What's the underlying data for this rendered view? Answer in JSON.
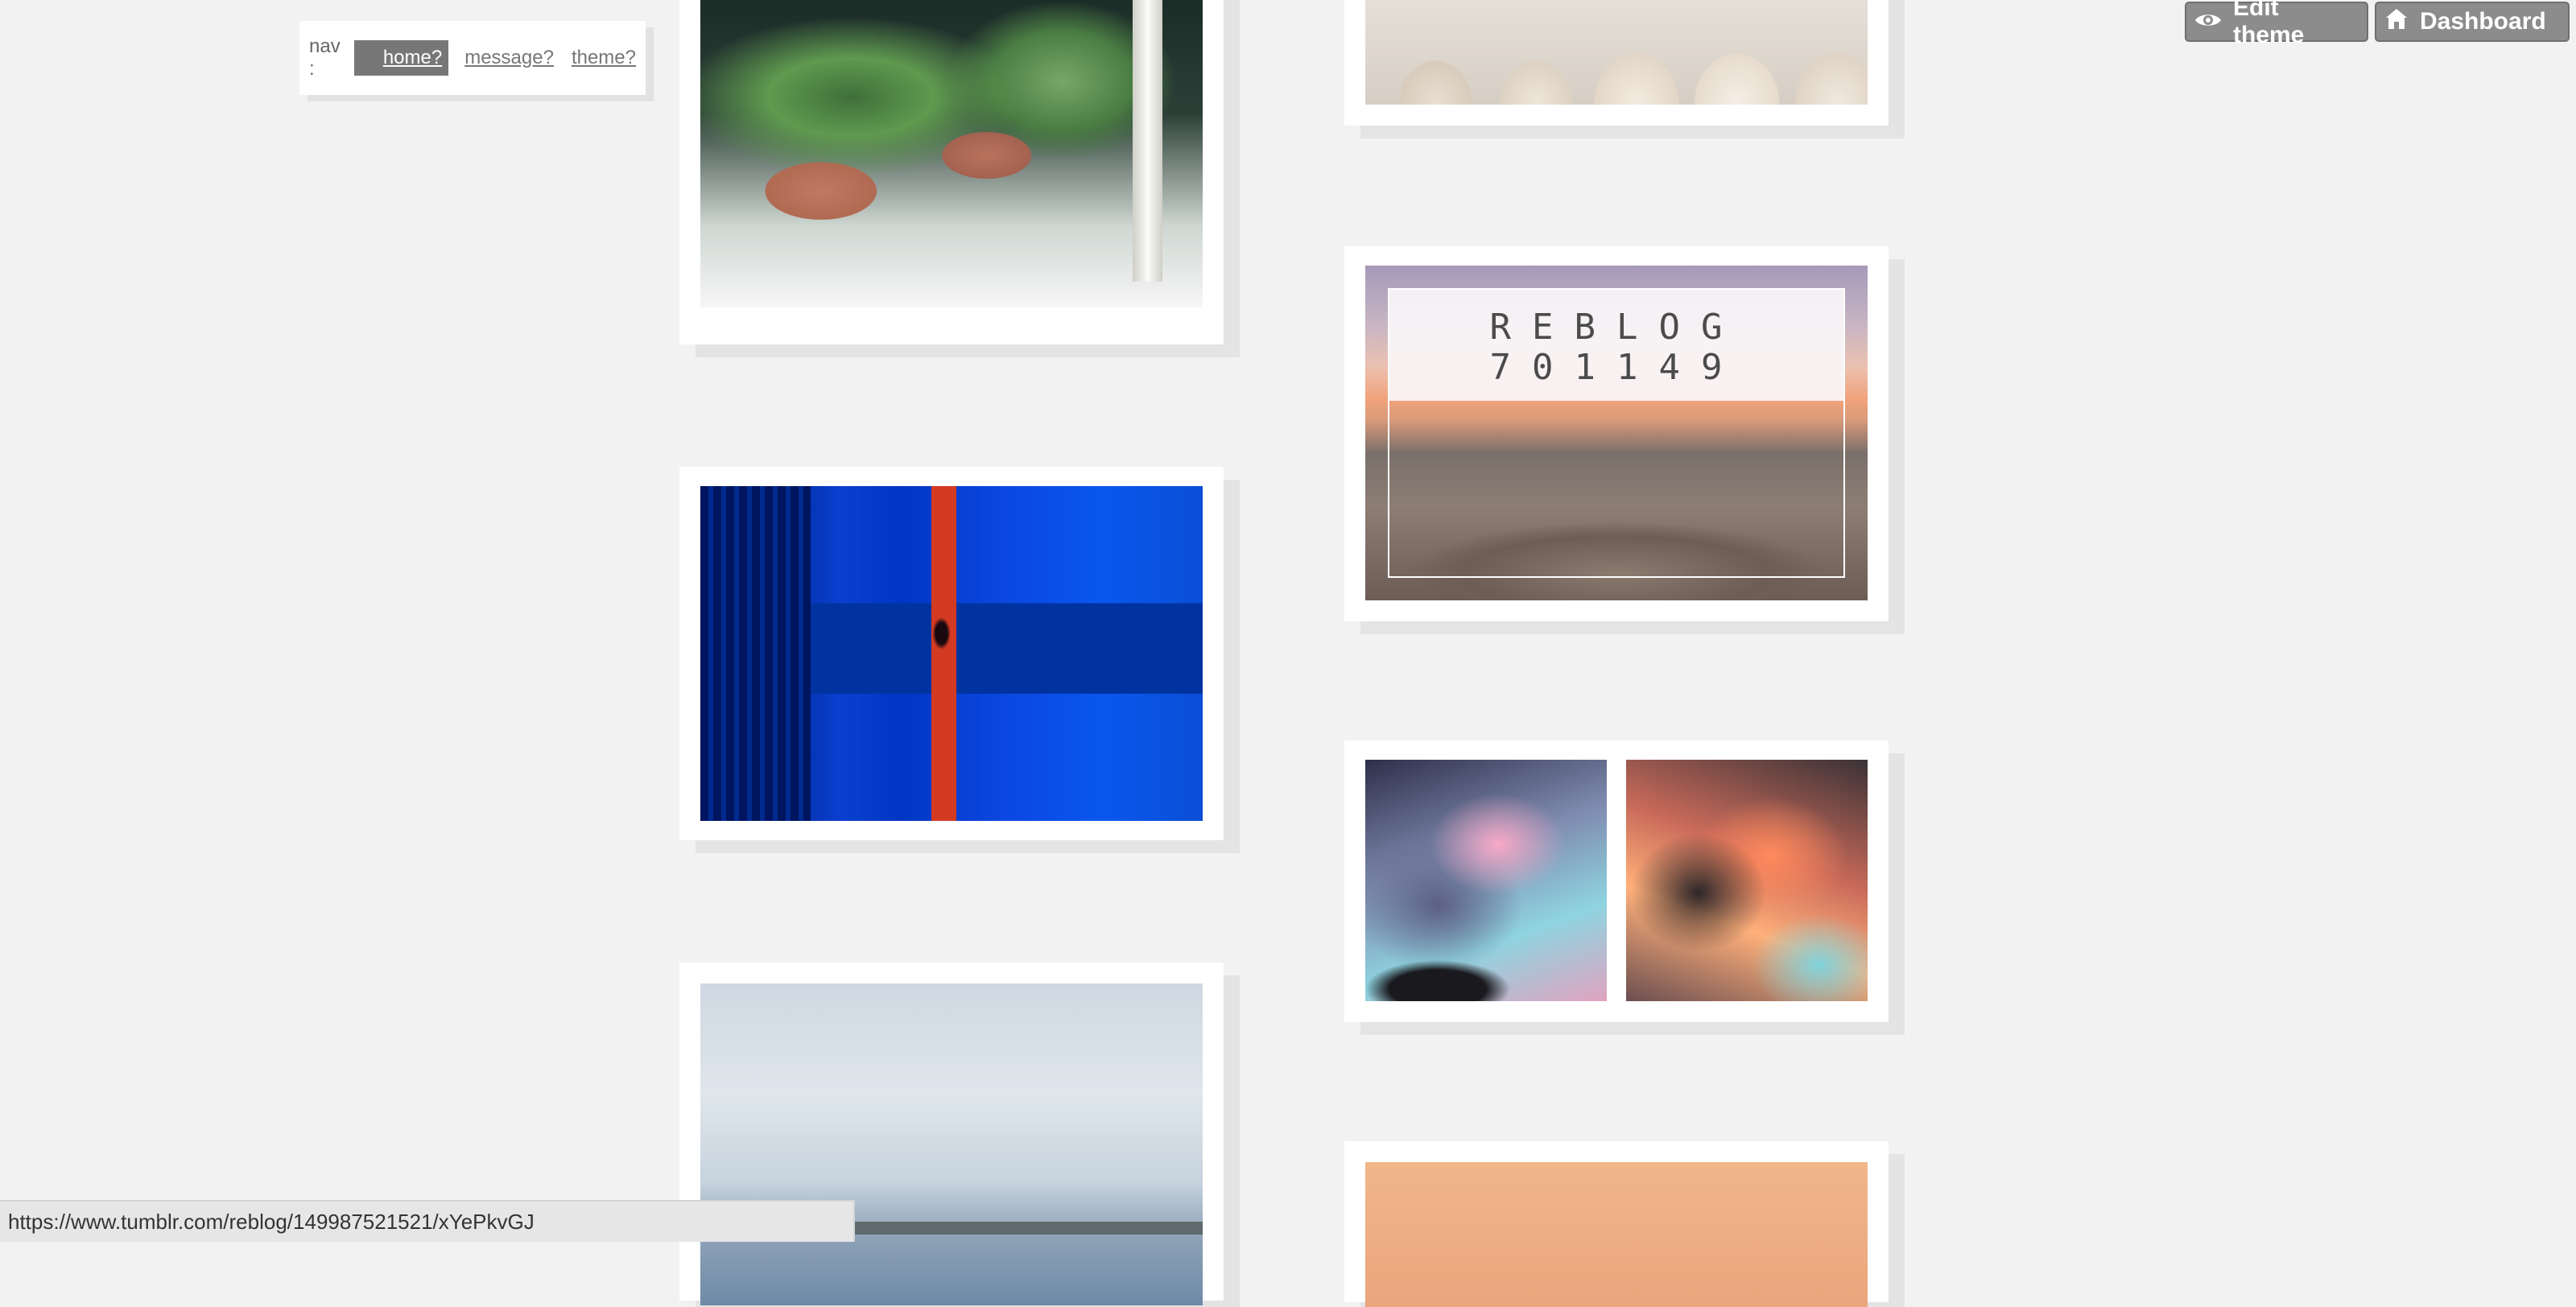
{
  "nav": {
    "prefix": "nav :",
    "links": [
      {
        "label": "home?",
        "active": true
      },
      {
        "label": "message?",
        "active": false
      },
      {
        "label": "theme?",
        "active": false
      }
    ]
  },
  "controls": {
    "edit_theme": {
      "label": "Edit theme",
      "icon": "eye-icon"
    },
    "dashboard": {
      "label": "Dashboard",
      "icon": "home-icon"
    }
  },
  "posts": {
    "reblog_overlay": {
      "line1": "REBLOG",
      "line2": "701149"
    }
  },
  "status_bar": {
    "url": "https://www.tumblr.com/reblog/149987521521/xYePkvGJ"
  },
  "colors": {
    "page_background": "#f2f2f2",
    "card_background": "#ffffff",
    "nav_active": "#777777",
    "control_button": "#8c8c8c"
  }
}
